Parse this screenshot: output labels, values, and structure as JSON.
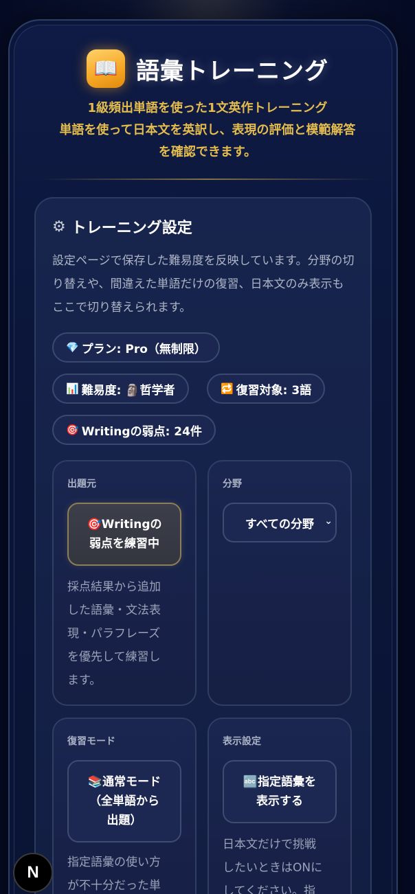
{
  "header": {
    "logo_icon": "book-icon",
    "title": "語彙トレーニング",
    "subtitle_line1": "1級頻出単語を使った1文英作トレーニング",
    "subtitle_line2": "単語を使って日本文を英訳し、表現の評価と模範解答",
    "subtitle_line3": "を確認できます。"
  },
  "settings": {
    "title": "トレーニング設定",
    "gear_icon": "gear-icon",
    "description": "設定ページで保存した難易度を反映しています。分野の切り替えや、間違えた単語だけの復習、日本文のみ表示もここで切り替えられます。",
    "badges": {
      "plan": "プラン: Pro（無制限）",
      "difficulty": "難易度: 🗿哲学者",
      "review_target": "復習対象: 3語",
      "writing_weak": "Writingの弱点: 24件"
    },
    "source_panel": {
      "label": "出題元",
      "button_line1": "🎯Writingの",
      "button_line2": "弱点を練習中",
      "text": "採点結果から追加した語彙・文法表現・パラフレーズを優先して練習します。"
    },
    "field_panel": {
      "label": "分野",
      "selected": "すべての分野"
    },
    "review_panel": {
      "label": "復習モード",
      "button_line1": "📚通常モード",
      "button_line2": "（全単語から",
      "button_line3": "出題）",
      "text": "指定語彙の使い方が不十分だった単"
    },
    "display_panel": {
      "label": "表示設定",
      "button_line1": "🔤指定語彙を",
      "button_line2": "表示する",
      "text": "日本文だけで挑戦したいときはONにしてください。指"
    }
  },
  "dev_badge": "N",
  "colors": {
    "accent_gold": "#e4bd4e",
    "background": "#060d24",
    "card": "#17244d"
  }
}
